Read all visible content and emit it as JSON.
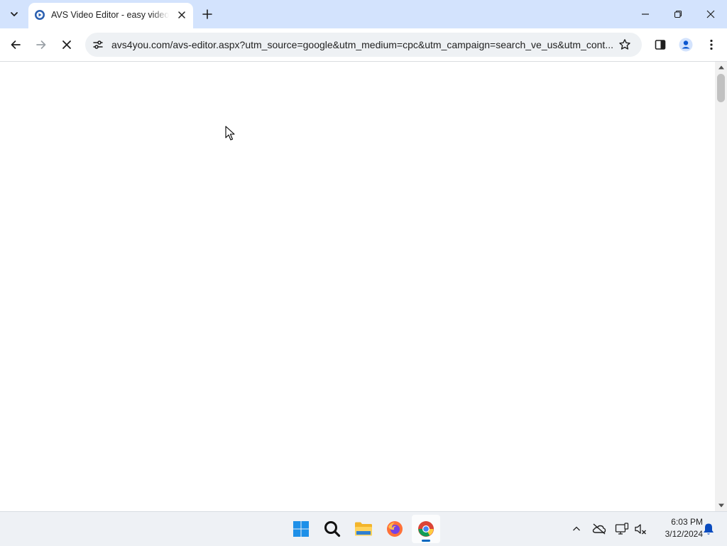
{
  "browser": {
    "tab": {
      "title": "AVS Video Editor - easy video editing software",
      "favicon": "avs4you-favicon"
    },
    "toolbar": {
      "url": "avs4you.com/avs-editor.aspx?utm_source=google&utm_medium=cpc&utm_campaign=search_ve_us&utm_cont...",
      "loading": true
    },
    "accent_color": "#d3e3fd"
  },
  "taskbar": {
    "apps": [
      "start",
      "search",
      "file-explorer",
      "firefox",
      "chrome"
    ],
    "active_app": "chrome",
    "clock": {
      "time": "6:03 PM",
      "date": "3/12/2024"
    },
    "tray_icons": [
      "chevron-up-icon",
      "onedrive-off-icon",
      "network-icon",
      "volume-muted-icon",
      "notification-bell-icon"
    ]
  }
}
